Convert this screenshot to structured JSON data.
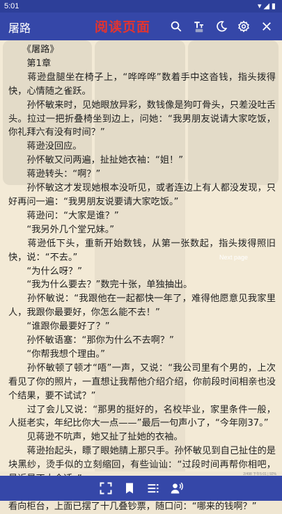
{
  "status_bar": {
    "time": "5:01",
    "icons": "▾◢▮"
  },
  "toolbar": {
    "book_title": "屠路",
    "page_label": "阅读页面",
    "icons": [
      "search-icon",
      "font-size-icon",
      "night-mode-icon",
      "settings-icon",
      "close-icon"
    ]
  },
  "overlay": {
    "next_page_label": "Next page"
  },
  "content": {
    "paragraphs": [
      "《屠路》",
      "第1章",
      "蒋逊盘腿坐在椅子上，“哗哗哗”数着手中这沓钱，指头拨得快，心情随之雀跃。",
      "孙怀敏来时，见她眼放异彩，数钱像是狗叮骨头，只差没吐舌头。拉过一把折叠椅坐到边上，问她：“我男朋友说请大家吃饭，你礼拜六有没有时间？”",
      "蒋逊没回应。",
      "孙怀敏又问两遍，扯扯她衣袖：“姐！”",
      "蒋逊转头：“啊？”",
      "孙怀敏这才发现她根本没听见，或者连边上有人都没发现，只好再问一遍：“我男朋友说要请大家吃饭。”",
      "蒋逊问：“大家是谁？”",
      "“我另外几个堂兄妹。”",
      "蒋逊低下头，重新开始数钱，从第一张数起，指头拨得照旧快，说：“不去。”",
      "“为什么呀？”",
      "“我为什么要去？”数完十张，单独抽出。",
      "孙怀敏说：“我跟他在一起都快一年了，难得他愿意见我家里人，我跟你最要好，你怎么能不去！”",
      "“谁跟你最要好了？”",
      "孙怀敏语塞：“那你为什么不去啊？”",
      "“你帮我想个理由。”",
      "孙怀敏顿了顿才“唔”一声，又说：“我公司里有个男的，上次看见了你的照片，一直想让我帮他介绍介绍，你前段时间相亲也没个结果，要不试试？”",
      "过了会儿又说：“那男的挺好的，名校毕业，家里条件一般，人挺老实，年纪比你大一点——”最后一句声小了，“今年刚37。”",
      "见蒋逊不吭声，她又扯了扯她的衣袖。",
      "蒋逊抬起头，瞟了眼她腈上那只手。孙怀敏见到自己扯住的是块黑纱，烫手似的立刻缩回，有些讪讪：“过段时间再帮你相吧，最近是不太合适。”",
      "蒋逊似笑非笑地看着她，仿佛戳破她心事，孙怀敏心头打鼓，看向柜台，上面已摆了十几叠钞票，随口问：“哪来的钱啊？”"
    ]
  },
  "footer": {
    "info": "2/498  下午5:01 | 92%"
  },
  "bottom_bar": {
    "icons": [
      "fullscreen-icon",
      "bookmark-icon",
      "chapter-list-icon",
      "read-aloud-icon"
    ]
  },
  "colors": {
    "bar": "#3547a8",
    "status_bar": "#2d3f99",
    "paper": "#f3ead6",
    "page_label": "#e3342f"
  }
}
